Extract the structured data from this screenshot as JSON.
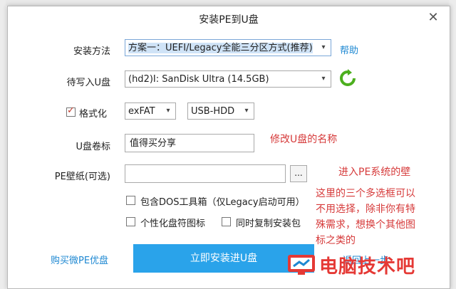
{
  "window": {
    "title": "安装PE到U盘",
    "close_glyph": "✕"
  },
  "install_method": {
    "label": "安装方法",
    "value": "方案一：UEFI/Legacy全能三分区方式(推荐)",
    "help_link": "帮助"
  },
  "target_disk": {
    "label": "待写入U盘",
    "value": "(hd2)I: SanDisk Ultra (14.5GB)"
  },
  "format": {
    "label": "格式化",
    "checked": true,
    "fs": "exFAT",
    "mode": "USB-HDD"
  },
  "volume_label": {
    "label": "U盘卷标",
    "value": "值得买分享"
  },
  "wallpaper": {
    "label": "PE壁纸(可选)",
    "value": "",
    "browse_label": "..."
  },
  "options": {
    "dos_tools": "包含DOS工具箱（仅Legacy启动可用）",
    "custom_icon": "个性化盘符图标",
    "copy_installer": "同时复制安装包"
  },
  "buy_link": "购买微PE优盘",
  "install_button": "立即安装进U盘",
  "partial_link": "返回上一步",
  "annotations": {
    "rename": "修改U盘的名称",
    "wallpaper": "进入PE系统的壁",
    "options_note": [
      "这里的三个多选框可以",
      "不用选择，除非你有特",
      "殊需求，想换个其他图",
      "标之类的"
    ]
  },
  "watermark": "电脑技术吧",
  "colors": {
    "accent": "#2aa3ea",
    "link": "#1e88d2",
    "annotation": "#d63a3a",
    "watermark": "#e53935"
  }
}
